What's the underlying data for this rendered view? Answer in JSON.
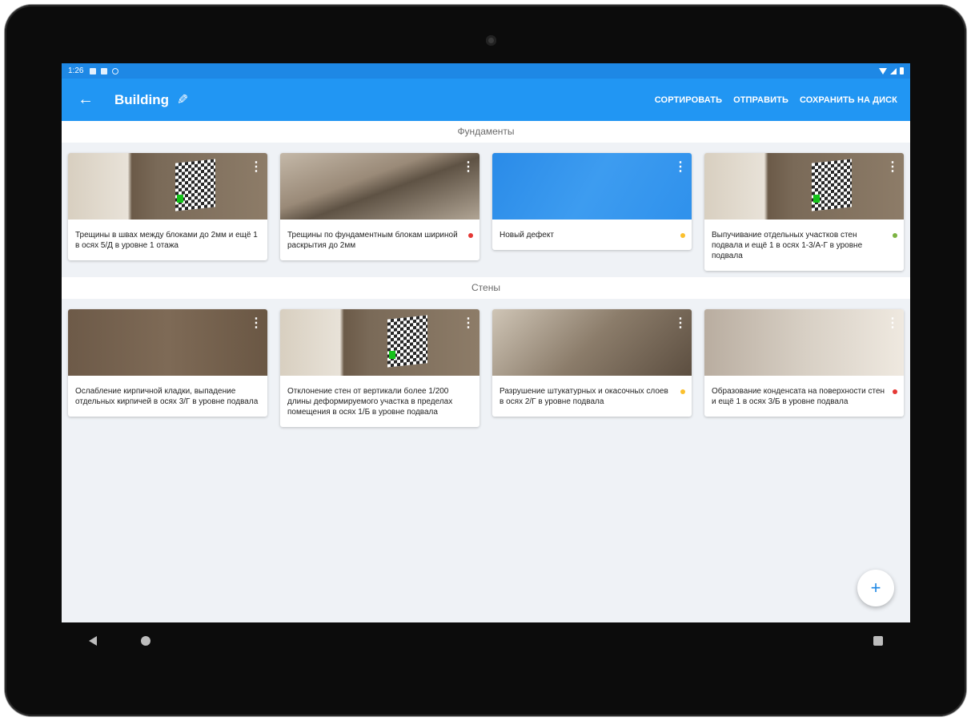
{
  "status_bar": {
    "time": "1:26"
  },
  "app_bar": {
    "title": "Building",
    "actions": [
      "СОРТИРОВАТЬ",
      "ОТПРАВИТЬ",
      "СОХРАНИТЬ НА ДИСК"
    ]
  },
  "sections": [
    {
      "title": "Фундаменты",
      "cards": [
        {
          "text": "Трещины в швах между блоками до 2мм и ещё 1 в осях 5/Д в уровне 1 отажа",
          "status": "",
          "image": "room-checker"
        },
        {
          "text": "Трещины по фундаментным блокам шириной раскрытия до 2мм",
          "status": "#e53935",
          "image": "floor"
        },
        {
          "text": "Новый дефект",
          "status": "#fbc02d",
          "image": "blue"
        },
        {
          "text": "Выпучивание отдельных участков стен подвала и ещё 1 в осях 1-3/А-Г в уровне подвала",
          "status": "#7cb342",
          "image": "room-checker"
        }
      ]
    },
    {
      "title": "Стены",
      "cards": [
        {
          "text": "Ослабление кирпичной кладки, выпадение отдельных кирпичей в осях 3/Г в уровне подвала",
          "status": "",
          "image": "wall"
        },
        {
          "text": "Отклонение стен от вертикали более 1/200 длины деформируемого участка в пределах помещения в осях 1/Б в уровне подвала",
          "status": "",
          "image": "room-checker"
        },
        {
          "text": "Разрушение штукатурных и окасочных слоев в осях 2/Г в уровне подвала",
          "status": "#fbc02d",
          "image": "plaster"
        },
        {
          "text": "Образование конденсата на поверхности стен и ещё 1 в осях 3/Б в уровне подвала",
          "status": "#e53935",
          "image": "living"
        }
      ]
    }
  ],
  "fab": {
    "label": "+"
  },
  "colors": {
    "primary": "#2196f3",
    "status_bar": "#1e88e5"
  }
}
